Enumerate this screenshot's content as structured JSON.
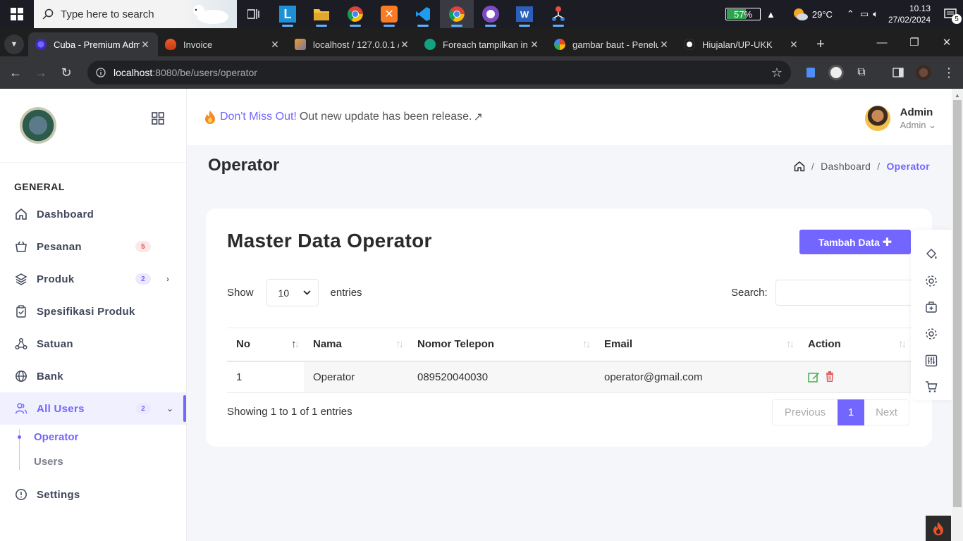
{
  "taskbar": {
    "search_placeholder": "Type here to search",
    "battery": "57%",
    "battery_level": 0.57,
    "weather": "29°C",
    "time": "10.13",
    "date": "27/02/2024",
    "notification_count": "5",
    "apps": [
      "task-view",
      "lapce",
      "file-explorer",
      "chrome",
      "xampp",
      "vscode",
      "chrome-active",
      "github-desktop",
      "word",
      "git-tool"
    ]
  },
  "browser": {
    "tabs": [
      {
        "title": "Cuba - Premium Adm",
        "icon": "cuba-favicon",
        "active": true
      },
      {
        "title": "Invoice",
        "icon": "codeigniter-favicon"
      },
      {
        "title": "localhost / 127.0.0.1 /",
        "icon": "phpmyadmin-favicon"
      },
      {
        "title": "Foreach tampilkan in",
        "icon": "chatgpt-favicon"
      },
      {
        "title": "gambar baut - Penelu",
        "icon": "google-favicon"
      },
      {
        "title": "Hiujalan/UP-UKK",
        "icon": "github-favicon"
      }
    ],
    "url_host": "localhost",
    "url_path": ":8080/be/users/operator"
  },
  "sidebar": {
    "section": "GENERAL",
    "items": [
      {
        "label": "Dashboard",
        "icon": "home-icon"
      },
      {
        "label": "Pesanan",
        "icon": "basket-icon",
        "badge": "5"
      },
      {
        "label": "Produk",
        "icon": "layers-icon",
        "badge": "2"
      },
      {
        "label": "Spesifikasi Produk",
        "icon": "clipboard-icon"
      },
      {
        "label": "Satuan",
        "icon": "nodes-icon"
      },
      {
        "label": "Bank",
        "icon": "globe-icon"
      },
      {
        "label": "All Users",
        "icon": "users-icon",
        "badge": "2"
      },
      {
        "label": "Settings",
        "icon": "info-icon"
      }
    ],
    "sub_items": [
      {
        "label": "Operator"
      },
      {
        "label": "Users"
      }
    ]
  },
  "topbar": {
    "notice_highlight": "Don't Miss Out!",
    "notice_text": "Out new update has been release.",
    "user_name": "Admin",
    "user_role": "Admin"
  },
  "page": {
    "title": "Operator",
    "breadcrumb": [
      "Dashboard",
      "Operator"
    ]
  },
  "card": {
    "title": "Master Data Operator",
    "add_button": "Tambah Data",
    "show_label": "Show",
    "entries_value": "10",
    "entries_label": "entries",
    "search_label": "Search:",
    "columns": [
      "No",
      "Nama",
      "Nomor Telepon",
      "Email",
      "Action"
    ],
    "rows": [
      {
        "no": "1",
        "nama": "Operator",
        "telepon": "089520040030",
        "email": "operator@gmail.com"
      }
    ],
    "info": "Showing 1 to 1 of 1 entries",
    "pager": {
      "prev": "Previous",
      "current": "1",
      "next": "Next"
    }
  },
  "colors": {
    "accent": "#7366ff",
    "danger": "#e05555",
    "success": "#3eb04a"
  }
}
